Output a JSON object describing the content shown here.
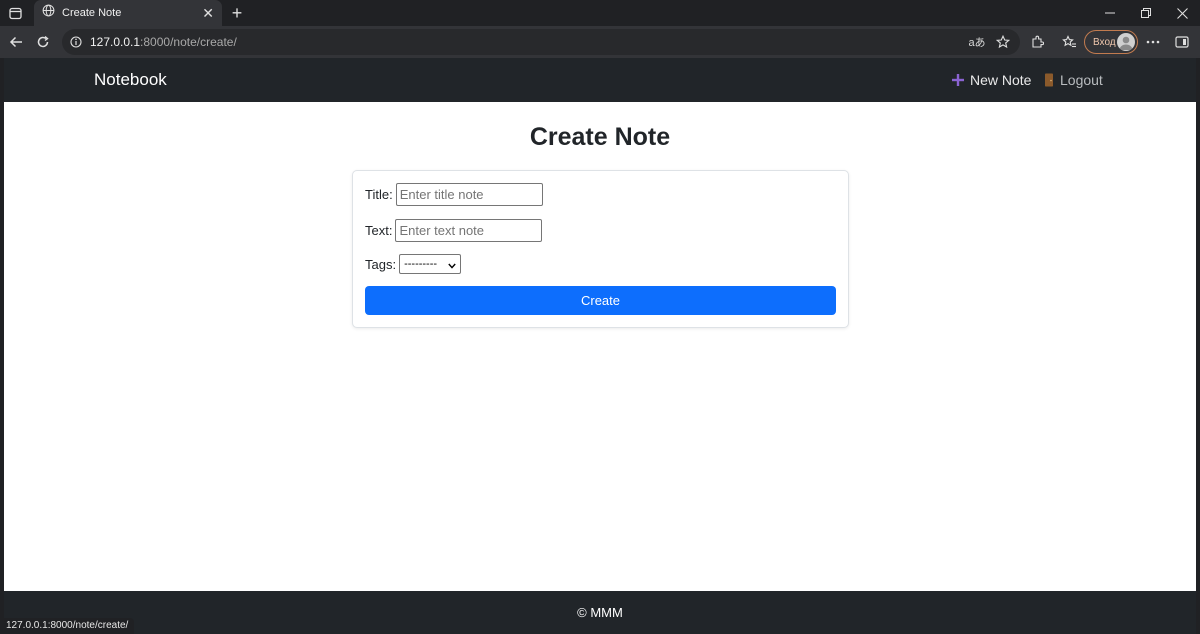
{
  "browser": {
    "tab_title": "Create Note",
    "url_host": "127.0.0.1",
    "url_rest": ":8000/note/create/",
    "profile_label": "Вход",
    "status_url": "127.0.0.1:8000/note/create/"
  },
  "navbar": {
    "brand": "Notebook",
    "new_note_label": "New Note",
    "logout_label": "Logout"
  },
  "page": {
    "heading": "Create Note"
  },
  "form": {
    "title_label": "Title:",
    "title_placeholder": "Enter title note",
    "title_value": "",
    "text_label": "Text:",
    "text_placeholder": "Enter text note",
    "text_value": "",
    "tags_label": "Tags:",
    "tags_selected": "---------",
    "submit_label": "Create"
  },
  "footer": {
    "text": "© MMM"
  },
  "colors": {
    "navbar_bg": "#212529",
    "primary_button": "#0d6efd",
    "new_note_icon": "#8a63d2",
    "logout_icon": "#8b5a2b"
  }
}
